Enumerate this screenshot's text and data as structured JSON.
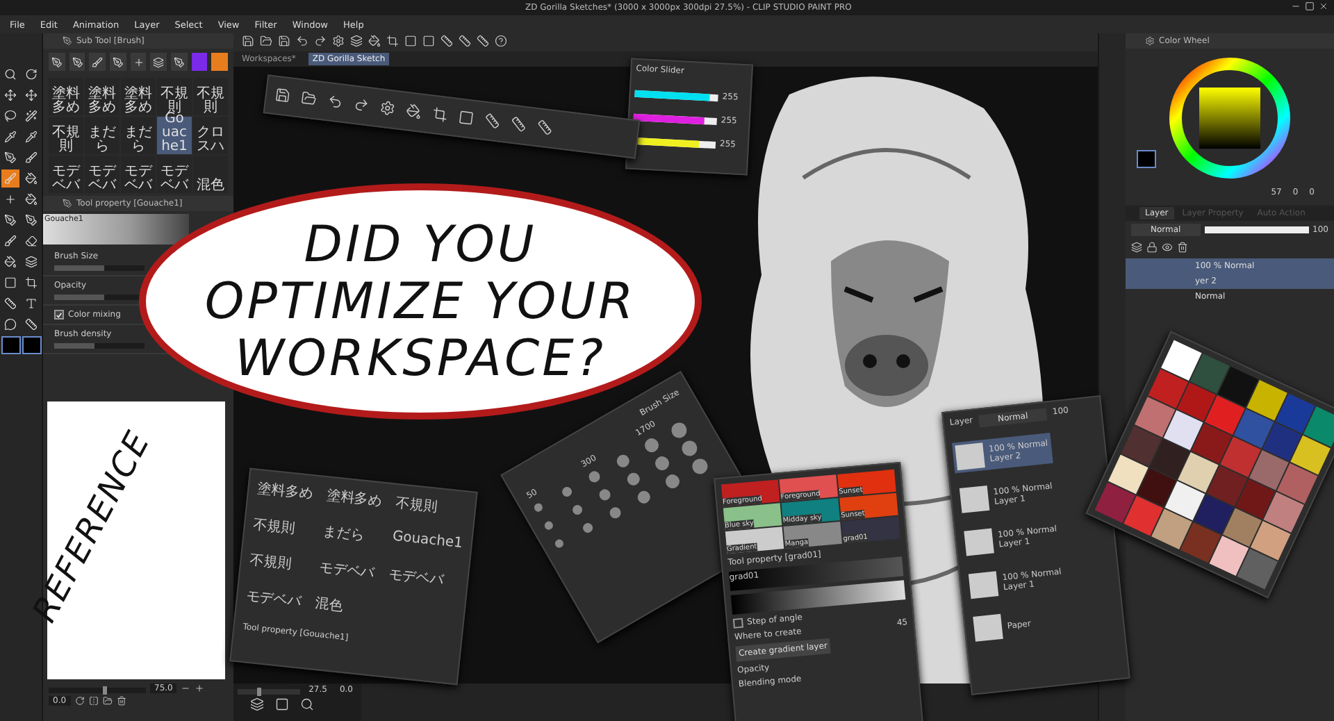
{
  "window": {
    "title": "ZD Gorilla Sketches* (3000 x 3000px 300dpi 27.5%)  - CLIP STUDIO PAINT PRO"
  },
  "menu": [
    "File",
    "Edit",
    "Animation",
    "Layer",
    "Select",
    "View",
    "Filter",
    "Window",
    "Help"
  ],
  "canvas_tabs": [
    {
      "label": "Workspaces*",
      "selected": false
    },
    {
      "label": "ZD Gorilla Sketch",
      "selected": true
    }
  ],
  "sub_tool": {
    "title": "Sub Tool [Brush]",
    "brushes": [
      {
        "label": "塗料多め",
        "selected": false
      },
      {
        "label": "塗料多め",
        "selected": false
      },
      {
        "label": "塗料多め",
        "selected": false
      },
      {
        "label": "不規則",
        "selected": false
      },
      {
        "label": "不規則",
        "selected": false
      },
      {
        "label": "不規則",
        "selected": false
      },
      {
        "label": "まだら",
        "selected": false
      },
      {
        "label": "まだら",
        "selected": false
      },
      {
        "label": "Gouache1",
        "selected": true
      },
      {
        "label": "クロスハ",
        "selected": false
      },
      {
        "label": "モデベバ",
        "selected": false
      },
      {
        "label": "モデベバ",
        "selected": false
      },
      {
        "label": "モデベバ",
        "selected": false
      },
      {
        "label": "モデベバ",
        "selected": false
      },
      {
        "label": "混色",
        "selected": false
      }
    ]
  },
  "tool_property": {
    "title": "Tool property [Gouache1]",
    "preview": "Gouache1",
    "rows": [
      {
        "kind": "slider",
        "label": "Brush Size",
        "level": 0.55
      },
      {
        "kind": "slider",
        "label": "Opacity",
        "level": 0.55
      },
      {
        "kind": "check",
        "label": "Color mixing",
        "checked": true
      },
      {
        "kind": "slider",
        "label": "Brush density",
        "level": 0.45
      }
    ]
  },
  "reference": {
    "text": "REFERENCE"
  },
  "navigator": {
    "zoom": "75.0",
    "angle": "0.0",
    "level": 0.55
  },
  "canvas_footer": {
    "zoom": "27.5",
    "angle": "0.0",
    "level": 0.3
  },
  "bubble": {
    "lines": [
      "DID YOU",
      "OPTIMIZE YOUR",
      "WORKSPACE?"
    ]
  },
  "color_slider": {
    "title": "Color Slider",
    "bars": [
      {
        "level": 0.9,
        "reading": "255"
      },
      {
        "level": 0.85,
        "reading": "255"
      },
      {
        "level": 0.8,
        "reading": "255"
      }
    ]
  },
  "brush_size": {
    "title": "Brush Size",
    "sizes": [
      "50",
      "300",
      "1700"
    ]
  },
  "gradient": {
    "sets": [
      "Foreground",
      "Foreground",
      "Sunset",
      "Blue sky",
      "Midday sky",
      "Sunset",
      "Gradient",
      "Manga",
      "grad01"
    ],
    "property_title": "Tool property [grad01]",
    "preview": "grad01",
    "step_label": "Step of angle",
    "step_checked": false,
    "where_label": "Where to create",
    "angle": "45",
    "create_button": "Create gradient layer",
    "opacity_label": "Opacity",
    "blend_label": "Blending mode"
  },
  "floating_sub_tool": {
    "labels": [
      "塗料多め",
      "塗料多め",
      "不規則",
      "不規則",
      "まだら",
      "Gouache1",
      "不規則",
      "モデベバ",
      "モデベバ",
      "モデベバ",
      "混色"
    ],
    "property_title": "Tool property [Gouache1]"
  },
  "floating_layers": {
    "title": "Layer",
    "blend": "Normal",
    "opacity": "100",
    "layers": [
      {
        "name": "Layer 2",
        "blend": "100 % Normal",
        "selected": true
      },
      {
        "name": "Layer 1",
        "blend": "100 % Normal",
        "selected": false
      },
      {
        "name": "Layer 1",
        "blend": "100 % Normal",
        "selected": false
      },
      {
        "name": "Layer 1",
        "blend": "100 % Normal",
        "selected": false
      },
      {
        "name": "Paper",
        "selected": false
      }
    ]
  },
  "color_wheel": {
    "title": "Color Wheel",
    "readouts": [
      "57",
      "0",
      "0"
    ]
  },
  "layer_panel": {
    "tabs": [
      {
        "label": "Layer",
        "selected": true
      },
      {
        "label": "Layer Property",
        "selected": false
      },
      {
        "label": "Auto Action",
        "selected": false
      }
    ],
    "blend": "Normal",
    "opacity": "100",
    "rows": [
      {
        "label": "100 % Normal",
        "selected": true
      },
      {
        "label": "yer 2",
        "selected": true
      },
      {
        "label": "Normal",
        "selected": false
      }
    ]
  }
}
